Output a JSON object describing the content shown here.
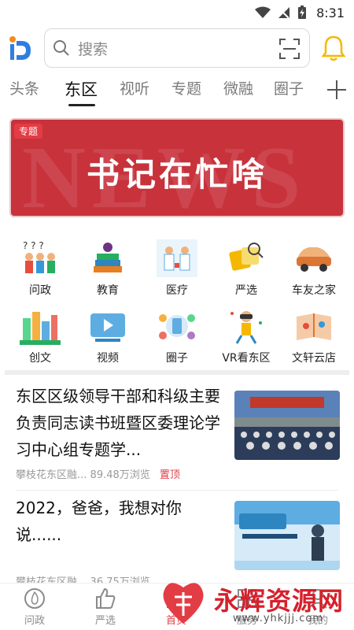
{
  "status": {
    "time": "8:31"
  },
  "search": {
    "placeholder": "搜索"
  },
  "tabs": [
    "头条",
    "东区",
    "视听",
    "专题",
    "微融",
    "圈子"
  ],
  "banner": {
    "tag": "专题",
    "bg_text": "NEWS",
    "title": "书记在忙啥"
  },
  "grid": [
    {
      "label": "问政"
    },
    {
      "label": "教育"
    },
    {
      "label": "医疗"
    },
    {
      "label": "严选"
    },
    {
      "label": "车友之家"
    },
    {
      "label": "创文"
    },
    {
      "label": "视频"
    },
    {
      "label": "圈子"
    },
    {
      "label": "VR看东区"
    },
    {
      "label": "文轩云店"
    }
  ],
  "news": [
    {
      "title": "东区区级领导干部和科级主要负责同志读书班暨区委理论学习中心组专题学...",
      "source": "攀枝花东区融...",
      "views": "89.48万浏览",
      "pin": "置顶"
    },
    {
      "title": "2022，爸爸，我想对你说......",
      "source": "攀枝花东区融...",
      "views": "36.75万浏览"
    }
  ],
  "bottom_nav": [
    {
      "label": "问政"
    },
    {
      "label": "严选"
    },
    {
      "label": "首页"
    },
    {
      "label": "服务"
    },
    {
      "label": "我的"
    }
  ],
  "watermark": {
    "text": "永辉资源网",
    "url": "www.yhkjjj.com"
  },
  "colors": {
    "accent": "#e23c45",
    "banner": "#c8323b",
    "bell": "#f5b800",
    "logo_blue": "#2f7de1"
  }
}
